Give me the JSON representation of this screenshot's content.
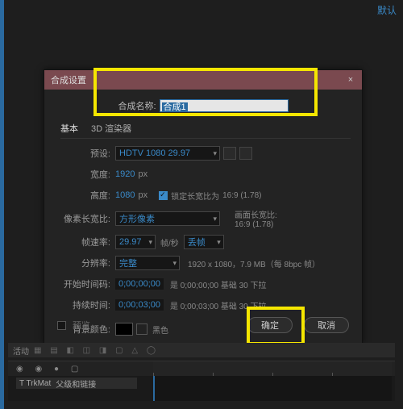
{
  "top_right": "默认",
  "dialog": {
    "title": "合成设置",
    "name_label": "合成名称:",
    "name_value": "合成1",
    "tabs": {
      "basic": "基本",
      "advanced": "3D 渲染器"
    },
    "preset_label": "预设:",
    "preset_value": "HDTV 1080 29.97",
    "width_label": "宽度:",
    "width_value": "1920",
    "height_label": "高度:",
    "height_value": "1080",
    "px": "px",
    "lock_aspect": "锁定长宽比为",
    "lock_aspect_val": "16:9 (1.78)",
    "par_label": "像素长宽比:",
    "par_value": "方形像素",
    "frame_aspect_label": "画面长宽比:",
    "frame_aspect_val": "16:9 (1.78)",
    "fps_label": "帧速率:",
    "fps_value": "29.97",
    "fps_unit": "帧/秒",
    "fps_drop": "丢帧",
    "res_label": "分辨率:",
    "res_value": "完整",
    "res_info": "1920 x 1080，7.9 MB（每 8bpc 帧）",
    "start_label": "开始时间码:",
    "start_value": "0;00;00;00",
    "start_info": "是 0;00;00;00 基础 30 下拉",
    "dur_label": "持续时间:",
    "dur_value": "0;00;03;00",
    "dur_info": "是 0;00;03;00 基础 30 下拉",
    "bg_label": "背景颜色:",
    "bg_name": "黑色",
    "preview": "预览",
    "ok": "确定",
    "cancel": "取消"
  },
  "bottom": {
    "zoom": "活动",
    "trkmat_label": "T  TrkMat",
    "parent_label": "父级和链接"
  }
}
